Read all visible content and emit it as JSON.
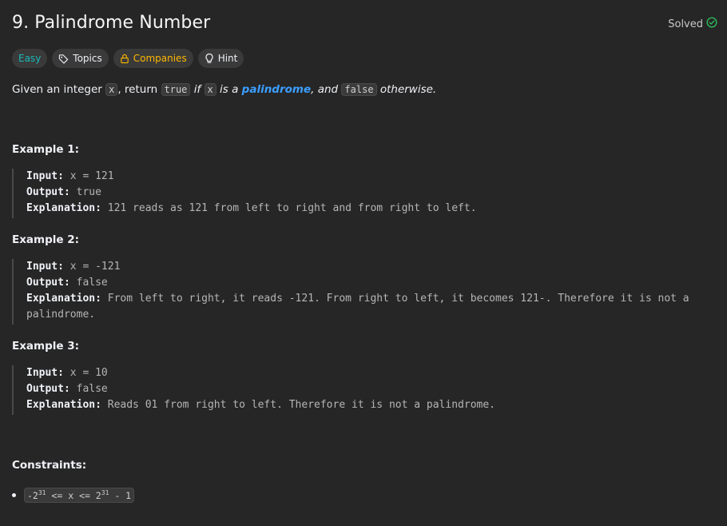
{
  "problem": {
    "title": "9. Palindrome Number",
    "status": "Solved"
  },
  "tags": {
    "difficulty": "Easy",
    "topics": "Topics",
    "companies": "Companies",
    "hint": "Hint"
  },
  "description": {
    "p1": "Given an integer ",
    "x": "x",
    "p2": ", return ",
    "true": "true",
    "p3": " if ",
    "x2": "x",
    "p4": " is a ",
    "link": "palindrome",
    "p5": ", and ",
    "false": "false",
    "p6": " otherwise."
  },
  "examples": [
    {
      "heading": "Example 1:",
      "input_label": "Input:",
      "input": " x = 121",
      "output_label": "Output:",
      "output": " true",
      "explanation_label": "Explanation:",
      "explanation": " 121 reads as 121 from left to right and from right to left."
    },
    {
      "heading": "Example 2:",
      "input_label": "Input:",
      "input": " x = -121",
      "output_label": "Output:",
      "output": " false",
      "explanation_label": "Explanation:",
      "explanation": " From left to right, it reads -121. From right to left, it becomes 121-. Therefore it is not a palindrome."
    },
    {
      "heading": "Example 3:",
      "input_label": "Input:",
      "input": " x = 10",
      "output_label": "Output:",
      "output": " false",
      "explanation_label": "Explanation:",
      "explanation": " Reads 01 from right to left. Therefore it is not a palindrome."
    }
  ],
  "constraints": {
    "heading": "Constraints:",
    "c1_a": "-2",
    "c1_exp1": "31",
    "c1_b": " <= x <= 2",
    "c1_exp2": "31",
    "c1_c": " - 1"
  },
  "colors": {
    "background": "#262626",
    "easy": "#1cbaba",
    "companies": "#ffb800",
    "link": "#3b9eff",
    "solved_check": "#2cbb5d"
  },
  "icons": {
    "solved": "check-circle-icon",
    "topics": "tag-icon",
    "companies": "lock-icon",
    "hint": "lightbulb-icon"
  }
}
